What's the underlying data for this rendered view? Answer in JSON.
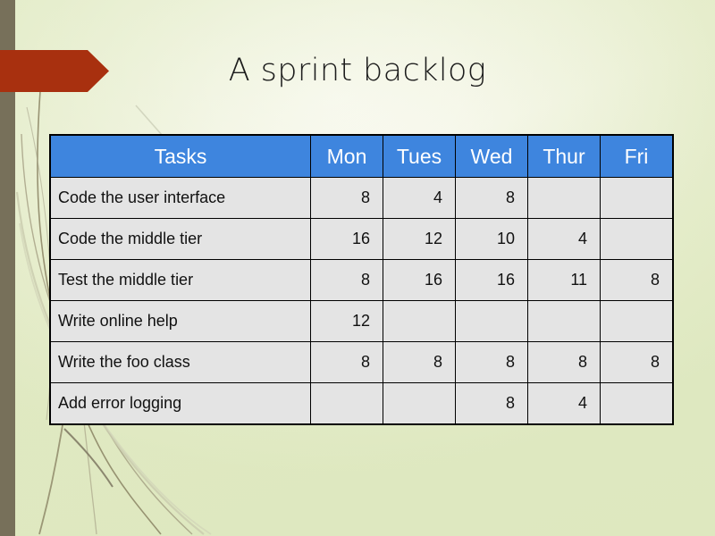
{
  "slide": {
    "title": "A sprint backlog",
    "colors": {
      "header_blue": "#3e85de",
      "cell_gray": "#e4e4e4",
      "accent_rust": "#a8300f",
      "left_bar_olive": "#77705a",
      "background_green": "#e4ecc9"
    }
  },
  "chart_data": {
    "type": "table",
    "title": "A sprint backlog",
    "columns": [
      "Tasks",
      "Mon",
      "Tues",
      "Wed",
      "Thur",
      "Fri"
    ],
    "rows": [
      {
        "task": "Code the user interface",
        "values": [
          "8",
          "4",
          "8",
          "",
          ""
        ]
      },
      {
        "task": "Code the middle tier",
        "values": [
          "16",
          "12",
          "10",
          "4",
          ""
        ]
      },
      {
        "task": "Test the middle tier",
        "values": [
          "8",
          "16",
          "16",
          "11",
          "8"
        ]
      },
      {
        "task": "Write online help",
        "values": [
          "12",
          "",
          "",
          "",
          ""
        ]
      },
      {
        "task": "Write the foo class",
        "values": [
          "8",
          "8",
          "8",
          "8",
          "8"
        ]
      },
      {
        "task": "Add error logging",
        "values": [
          "",
          "",
          "8",
          "4",
          ""
        ]
      }
    ]
  }
}
